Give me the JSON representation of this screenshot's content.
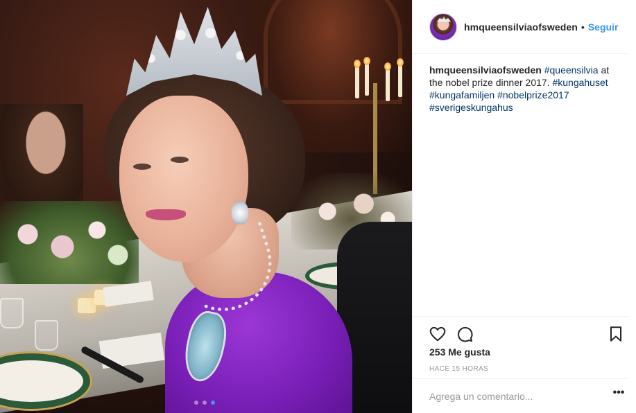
{
  "post": {
    "author": {
      "username": "hmqueensilviaofsweden",
      "separator": "•",
      "follow_label": "Seguir"
    },
    "caption": {
      "username": "hmqueensilviaofsweden",
      "tag_1": "#queensilvia",
      "text_1": " at the nobel prize dinner 2017. ",
      "tag_2": "#kungahuset",
      "tag_3": "#kungafamiljen",
      "tag_4": "#nobelprize2017",
      "tag_5": "#sverigeskungahus"
    },
    "likes_text": "253 Me gusta",
    "timestamp": "HACE 15 HORAS",
    "comment_placeholder": "Agrega un comentario...",
    "more_label": "•••",
    "carousel": {
      "total": 3,
      "active_index": 3
    },
    "icons": {
      "like": "heart-icon",
      "comment": "comment-icon",
      "save": "bookmark-icon",
      "more": "ellipsis-icon"
    },
    "colors": {
      "link_blue": "#3897f0",
      "hashtag": "#003569",
      "text": "#262626",
      "muted": "#999999",
      "dress_purple": "#7a1fb8"
    }
  }
}
